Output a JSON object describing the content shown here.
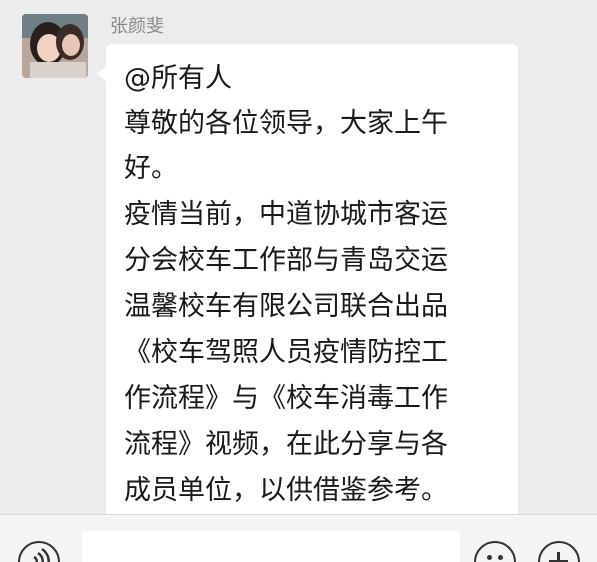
{
  "message": {
    "sender": "张颜斐",
    "lines": [
      "@所有人",
      "尊敬的各位领导，大家上午",
      "好。",
      "疫情当前，中道协城市客运",
      "分会校车工作部与青岛交运",
      "温馨校车有限公司联合出品",
      "《校车驾照人员疫情防控工",
      "作流程》与《校车消毒工作",
      "流程》视频，在此分享与各",
      "成员单位，以供借鉴参考。"
    ]
  },
  "input_bar": {
    "icons": [
      "voice-icon",
      "emoji-icon",
      "plus-icon"
    ]
  }
}
